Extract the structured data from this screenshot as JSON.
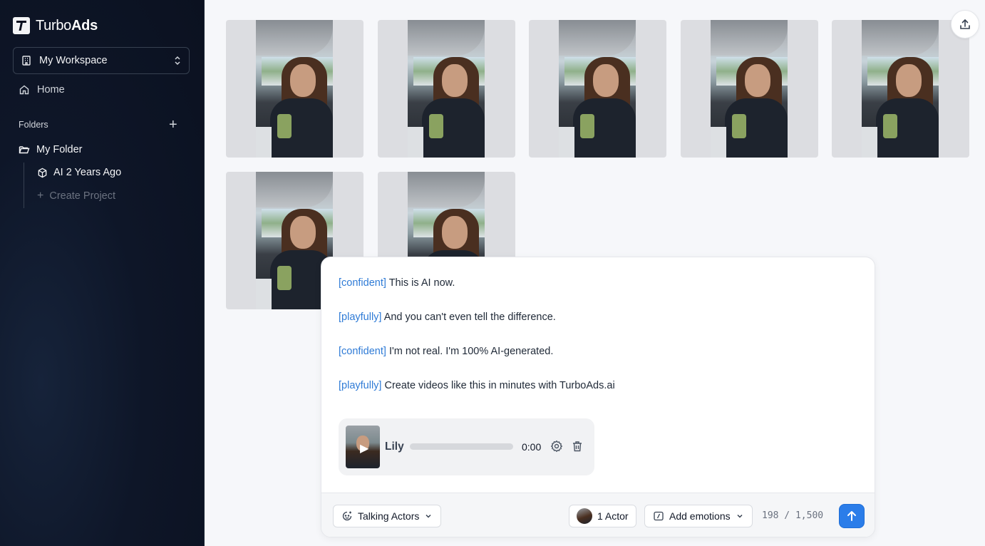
{
  "app": {
    "brand_light": "Turbo",
    "brand_bold": "Ads"
  },
  "sidebar": {
    "workspace": "My Workspace",
    "home": "Home",
    "folders_label": "Folders",
    "folder": "My Folder",
    "project": "AI 2 Years Ago",
    "create_project": "Create Project"
  },
  "gallery": {
    "thumbnail_count": 7
  },
  "composer": {
    "lines": [
      {
        "tag": "[confident]",
        "text": "This is AI now."
      },
      {
        "tag": "[playfully]",
        "text": "And you can't even tell the difference."
      },
      {
        "tag": "[confident]",
        "text": "I'm not real. I'm 100% AI-generated."
      },
      {
        "tag": "[playfully]",
        "text": "Create videos like this in minutes with TurboAds.ai"
      }
    ],
    "voice": {
      "name": "Lily",
      "time": "0:00",
      "progress": 0
    },
    "toolbar": {
      "mode": "Talking Actors",
      "actors": "1 Actor",
      "emotions": "Add emotions",
      "counter": "198 / 1,500"
    }
  },
  "colors": {
    "accent": "#2b7de9",
    "tag": "#2f7bd6",
    "sidebar_bg": "#0e1628"
  }
}
